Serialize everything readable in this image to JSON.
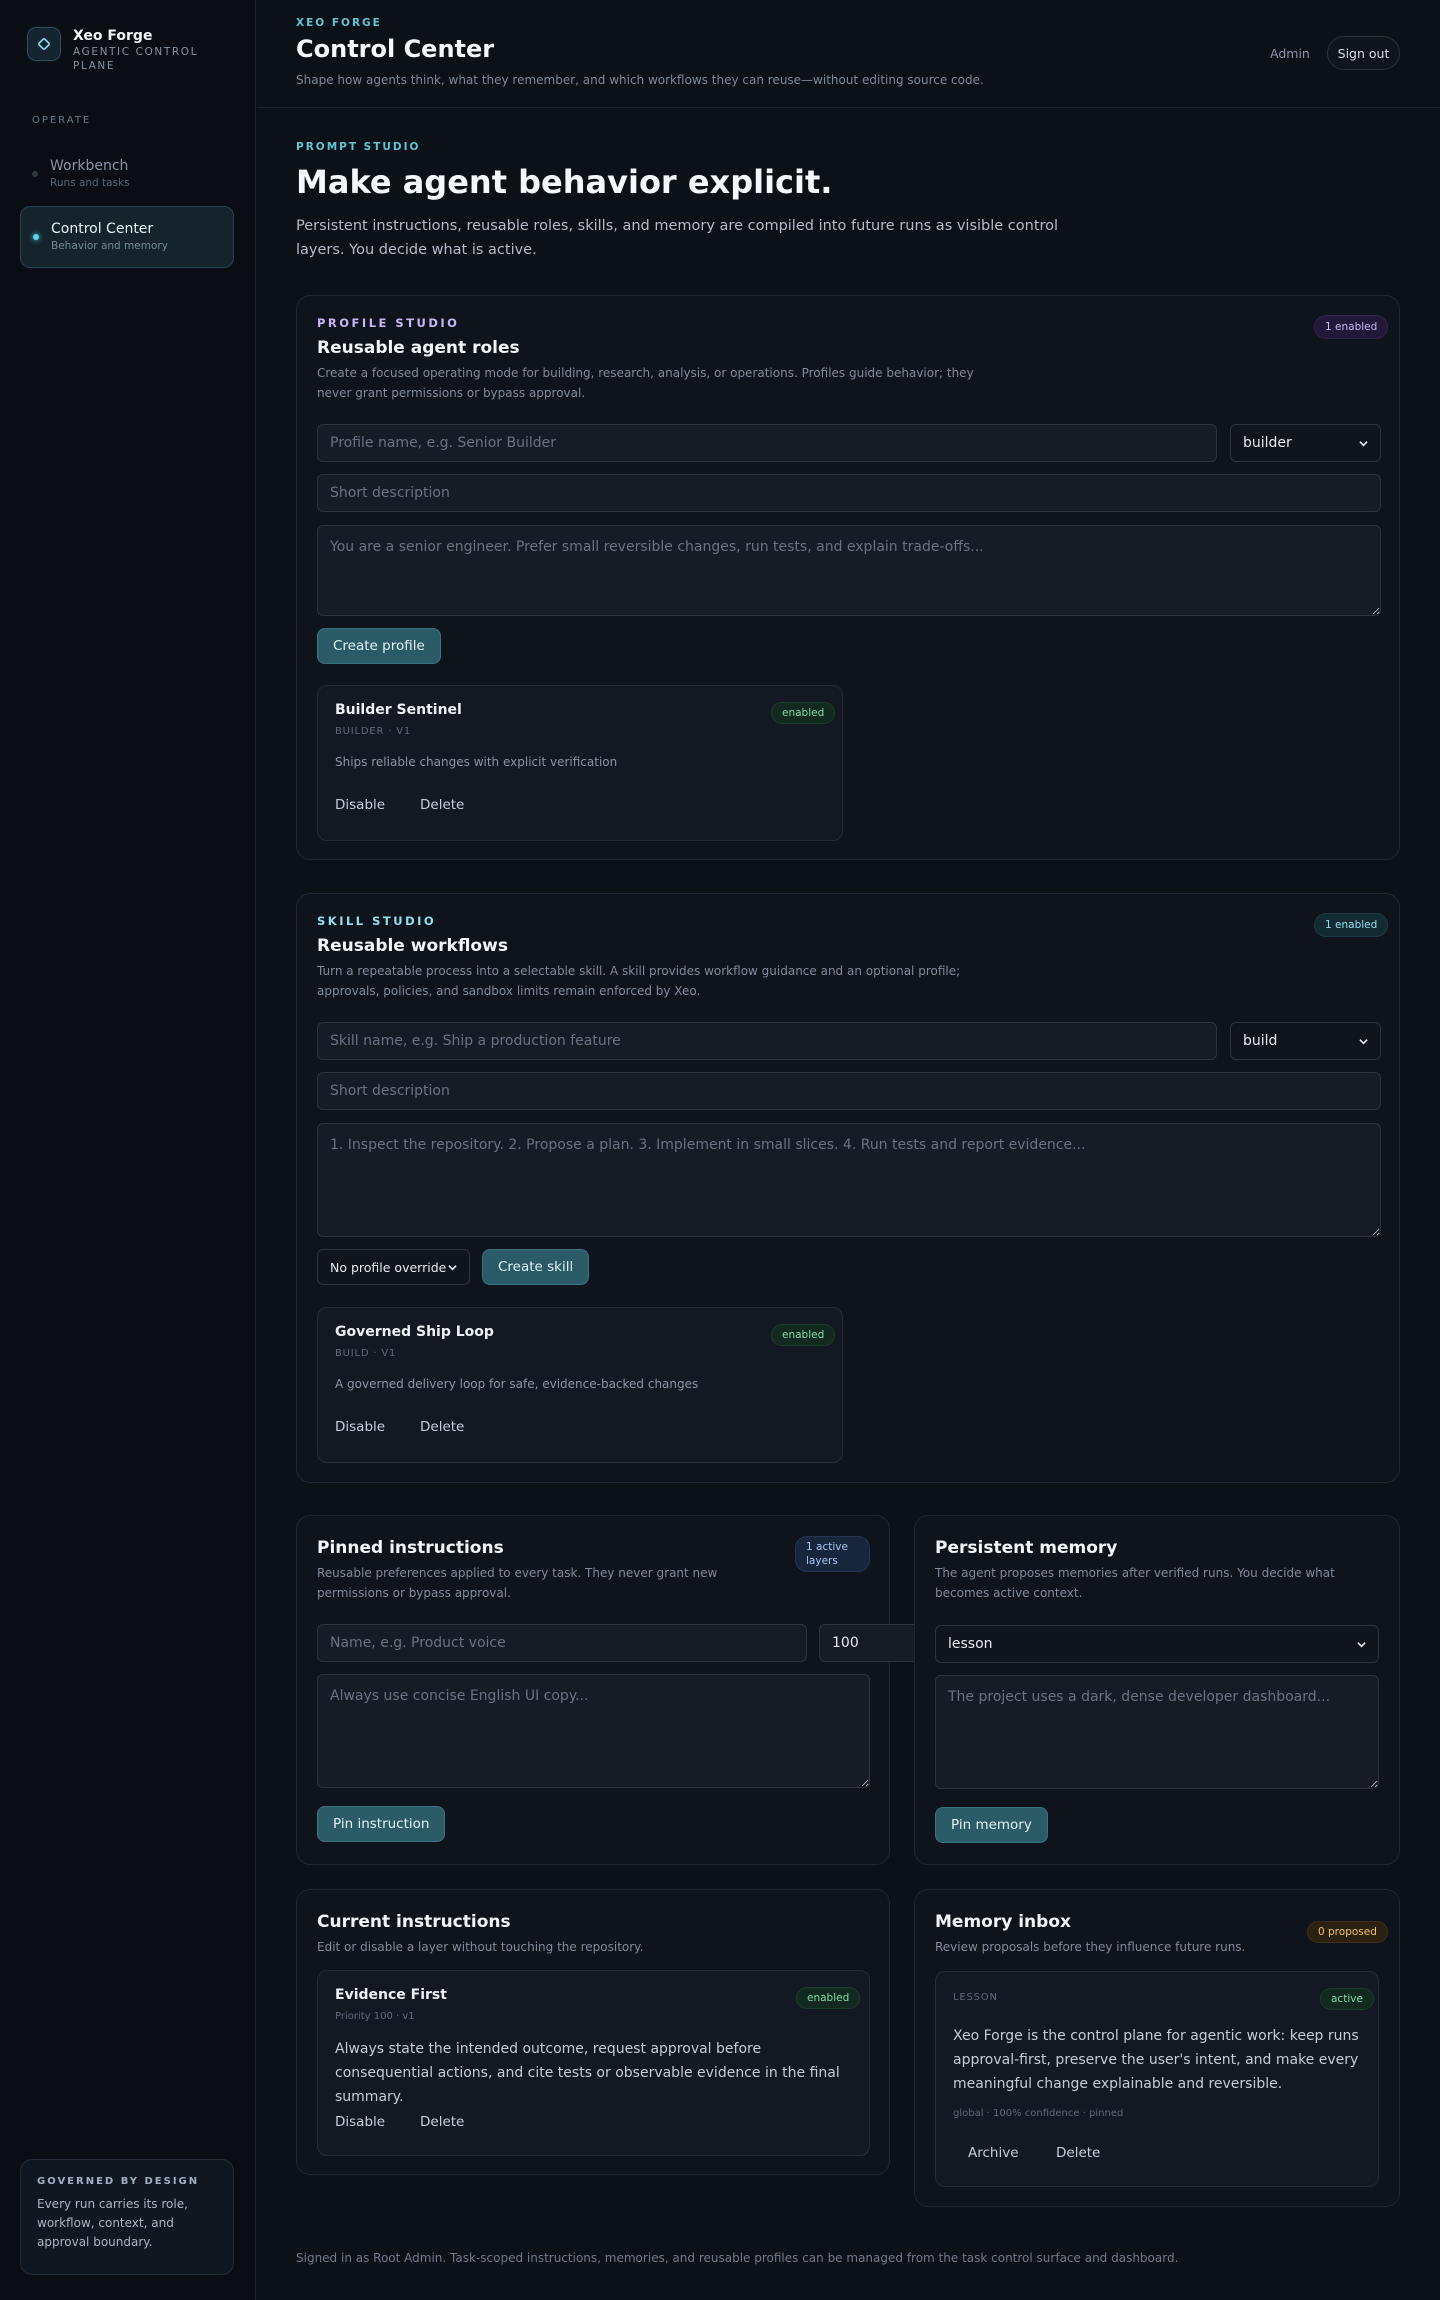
{
  "sidebar": {
    "brand_name": "Xeo Forge",
    "brand_sub": "Agentic control plane",
    "section_label": "OPERATE",
    "items": [
      {
        "label": "Workbench",
        "sub": "Runs and tasks",
        "active": false
      },
      {
        "label": "Control Center",
        "sub": "Behavior and memory",
        "active": true
      }
    ],
    "card": {
      "title": "GOVERNED BY DESIGN",
      "text": "Every run carries its role, workflow, context, and approval boundary."
    }
  },
  "header": {
    "eyebrow": "XEO FORGE",
    "title": "Control Center",
    "subtitle": "Shape how agents think, what they remember, and which workflows they can reuse—without editing source code.",
    "admin_label": "Admin",
    "signout_label": "Sign out"
  },
  "hero": {
    "eyebrow": "PROMPT STUDIO",
    "title": "Make agent behavior explicit.",
    "text": "Persistent instructions, reusable roles, skills, and memory are compiled into future runs as visible control layers. You decide what is active."
  },
  "profile_studio": {
    "eyebrow": "PROFILE STUDIO",
    "title": "Reusable agent roles",
    "desc": "Create a focused operating mode for building, research, analysis, or operations. Profiles guide behavior; they never grant permissions or bypass approval.",
    "badge": "1 enabled",
    "name_placeholder": "Profile name, e.g. Senior Builder",
    "role_select": "builder",
    "desc_placeholder": "Short description",
    "prompt_placeholder": "You are a senior engineer. Prefer small reversible changes, run tests, and explain trade-offs...",
    "create_label": "Create profile",
    "card": {
      "title": "Builder Sentinel",
      "meta": "BUILDER · V1",
      "badge": "enabled",
      "desc": "Ships reliable changes with explicit verification",
      "disable_label": "Disable",
      "delete_label": "Delete"
    }
  },
  "skill_studio": {
    "eyebrow": "SKILL STUDIO",
    "title": "Reusable workflows",
    "desc": "Turn a repeatable process into a selectable skill. A skill provides workflow guidance and an optional profile; approvals, policies, and sandbox limits remain enforced by Xeo.",
    "badge": "1 enabled",
    "name_placeholder": "Skill name, e.g. Ship a production feature",
    "type_select": "build",
    "desc_placeholder": "Short description",
    "steps_placeholder": "1. Inspect the repository. 2. Propose a plan. 3. Implement in small slices. 4. Run tests and report evidence...",
    "profile_select": "No profile override",
    "create_label": "Create skill",
    "card": {
      "title": "Governed Ship Loop",
      "meta": "BUILD · V1",
      "badge": "enabled",
      "desc": "A governed delivery loop for safe, evidence-backed changes",
      "disable_label": "Disable",
      "delete_label": "Delete"
    }
  },
  "pinned": {
    "title": "Pinned instructions",
    "desc": "Reusable preferences applied to every task. They never grant new permissions or bypass approval.",
    "badge": "1 active layers",
    "name_placeholder": "Name, e.g. Product voice",
    "priority_value": "100",
    "text_placeholder": "Always use concise English UI copy...",
    "submit_label": "Pin instruction"
  },
  "memory": {
    "title": "Persistent memory",
    "desc": "The agent proposes memories after verified runs. You decide what becomes active context.",
    "kind_select": "lesson",
    "text_placeholder": "The project uses a dark, dense developer dashboard...",
    "submit_label": "Pin memory"
  },
  "current": {
    "title": "Current instructions",
    "desc": "Edit or disable a layer without touching the repository.",
    "card": {
      "title": "Evidence First",
      "meta": "Priority 100 · v1",
      "badge": "enabled",
      "body": "Always state the intended outcome, request approval before consequential actions, and cite tests or observable evidence in the final summary.",
      "disable_label": "Disable",
      "delete_label": "Delete"
    }
  },
  "inbox": {
    "title": "Memory inbox",
    "desc": "Review proposals before they influence future runs.",
    "badge": "0 proposed",
    "card": {
      "kind": "LESSON",
      "badge": "active",
      "body": "Xeo Forge is the control plane for agentic work: keep runs approval-first, preserve the user's intent, and make every meaningful change explainable and reversible.",
      "meta": "global · 100% confidence · pinned",
      "archive_label": "Archive",
      "delete_label": "Delete"
    }
  },
  "footer": "Signed in as Root Admin. Task-scoped instructions, memories, and reusable profiles can be managed from the task control surface and dashboard.",
  "colors": {
    "accent": "#5fc6d8",
    "primary_button": "#2c5b68",
    "profile_eyebrow": "#c9b7f5",
    "skill_eyebrow": "#8fe0ef",
    "background": "#0c1017"
  }
}
